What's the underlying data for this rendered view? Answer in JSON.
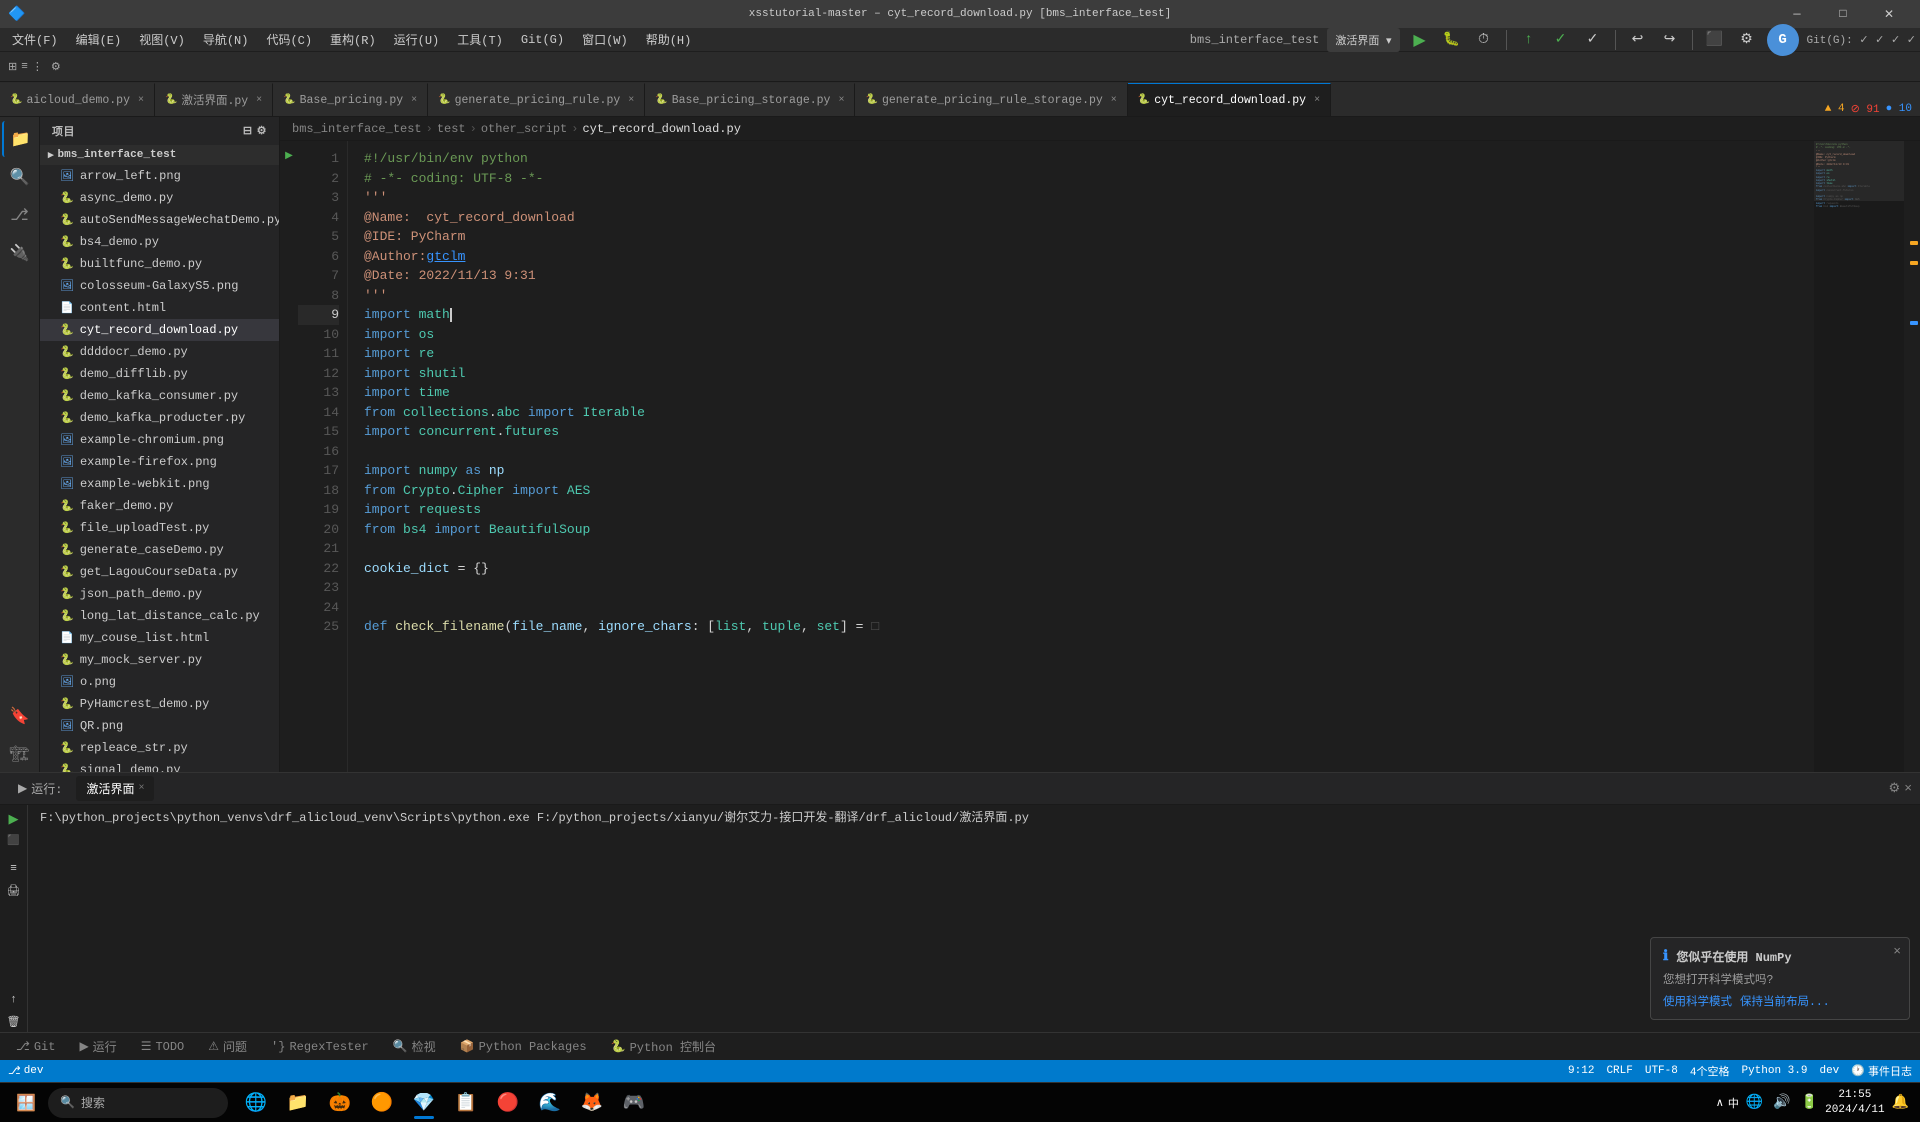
{
  "app": {
    "title": "xsstutorial-master – cyt_record_download.py [bms_interface_test]",
    "version": "PyCharm"
  },
  "titlebar": {
    "menu_items": [
      "文件(F)",
      "编辑(E)",
      "视图(V)",
      "导航(N)",
      "代码(C)",
      "重构(R)",
      "运行(U)",
      "工具(T)",
      "Git(G)",
      "窗口(W)",
      "帮助(H)"
    ],
    "project_name": "bms_interface_test",
    "minimize": "—",
    "maximize": "□",
    "close": "✕"
  },
  "breadcrumb": {
    "project": "bms_interface_test",
    "folder1": "test",
    "folder2": "other_script",
    "file": "cyt_record_download.py"
  },
  "tabs": [
    {
      "label": "aicloud_demo.py",
      "active": false,
      "icon": "🐍"
    },
    {
      "label": "激活界面.py",
      "active": false,
      "icon": "🐍"
    },
    {
      "label": "Base_pricing.py",
      "active": false,
      "icon": "🐍"
    },
    {
      "label": "generate_pricing_rule.py",
      "active": false,
      "icon": "🐍"
    },
    {
      "label": "Base_pricing_storage.py",
      "active": false,
      "icon": "🐍"
    },
    {
      "label": "generate_pricing_rule_storage.py",
      "active": false,
      "icon": "🐍"
    },
    {
      "label": "cyt_record_download.py",
      "active": true,
      "icon": "🐍"
    }
  ],
  "explorer": {
    "header": "项目",
    "sections": [
      {
        "name": "bms_interface_test",
        "files": [
          {
            "name": "arrow_left.png",
            "icon": "🖼",
            "type": "png"
          },
          {
            "name": "async_demo.py",
            "icon": "🐍",
            "type": "py"
          },
          {
            "name": "autoSendMessageWechatDemo.py",
            "icon": "🐍",
            "type": "py"
          },
          {
            "name": "bs4_demo.py",
            "icon": "🐍",
            "type": "py"
          },
          {
            "name": "builtfunc_demo.py",
            "icon": "🐍",
            "type": "py"
          },
          {
            "name": "colosseum-GalaxyS5.png",
            "icon": "🖼",
            "type": "png"
          },
          {
            "name": "content.html",
            "icon": "📄",
            "type": "html"
          },
          {
            "name": "cyt_record_download.py",
            "icon": "🐍",
            "type": "py",
            "active": true
          },
          {
            "name": "ddddocr_demo.py",
            "icon": "🐍",
            "type": "py"
          },
          {
            "name": "demo_difflib.py",
            "icon": "🐍",
            "type": "py"
          },
          {
            "name": "demo_kafka_consumer.py",
            "icon": "🐍",
            "type": "py"
          },
          {
            "name": "demo_kafka_producter.py",
            "icon": "🐍",
            "type": "py"
          },
          {
            "name": "example-chromium.png",
            "icon": "🖼",
            "type": "png"
          },
          {
            "name": "example-firefox.png",
            "icon": "🖼",
            "type": "png"
          },
          {
            "name": "example-webkit.png",
            "icon": "🖼",
            "type": "png"
          },
          {
            "name": "faker_demo.py",
            "icon": "🐍",
            "type": "py"
          },
          {
            "name": "file_uploadTest.py",
            "icon": "🐍",
            "type": "py"
          },
          {
            "name": "generate_caseDemo.py",
            "icon": "🐍",
            "type": "py"
          },
          {
            "name": "get_LagouCourseData.py",
            "icon": "🐍",
            "type": "py"
          },
          {
            "name": "json_path_demo.py",
            "icon": "🐍",
            "type": "py"
          },
          {
            "name": "long_lat_distance_calc.py",
            "icon": "🐍",
            "type": "py"
          },
          {
            "name": "my_couse_list.html",
            "icon": "📄",
            "type": "html"
          },
          {
            "name": "my_mock_server.py",
            "icon": "🐍",
            "type": "py"
          },
          {
            "name": "o.png",
            "icon": "🖼",
            "type": "png"
          },
          {
            "name": "PyHamcrest_demo.py",
            "icon": "🐍",
            "type": "py"
          },
          {
            "name": "QR.png",
            "icon": "🖼",
            "type": "png"
          },
          {
            "name": "repleace_str.py",
            "icon": "🐍",
            "type": "py"
          },
          {
            "name": "signal_demo.py",
            "icon": "🐍",
            "type": "py"
          }
        ]
      }
    ]
  },
  "code": {
    "filename": "cyt_record_download.py",
    "lines": [
      {
        "num": 1,
        "content": "#!/usr/bin/env python"
      },
      {
        "num": 2,
        "content": "# -*- coding: UTF-8 -*-"
      },
      {
        "num": 3,
        "content": "'''"
      },
      {
        "num": 4,
        "content": "@Name:  cyt_record_download"
      },
      {
        "num": 5,
        "content": "@IDE: PyCharm"
      },
      {
        "num": 6,
        "content": "@Author:gtclm"
      },
      {
        "num": 7,
        "content": "@Date: 2022/11/13 9:31"
      },
      {
        "num": 8,
        "content": "'''"
      },
      {
        "num": 9,
        "content": "import math"
      },
      {
        "num": 10,
        "content": "import os"
      },
      {
        "num": 11,
        "content": "import re"
      },
      {
        "num": 12,
        "content": "import shutil"
      },
      {
        "num": 13,
        "content": "import time"
      },
      {
        "num": 14,
        "content": "from collections.abc import Iterable"
      },
      {
        "num": 15,
        "content": "import concurrent.futures"
      },
      {
        "num": 16,
        "content": ""
      },
      {
        "num": 17,
        "content": "import numpy as np"
      },
      {
        "num": 18,
        "content": "from Crypto.Cipher import AES"
      },
      {
        "num": 19,
        "content": "import requests"
      },
      {
        "num": 20,
        "content": "from bs4 import BeautifulSoup"
      },
      {
        "num": 21,
        "content": ""
      },
      {
        "num": 22,
        "content": "cookie_dict = {}"
      },
      {
        "num": 23,
        "content": ""
      },
      {
        "num": 24,
        "content": ""
      },
      {
        "num": 25,
        "content": "def check_filename(file_name, ignore_chars: [list, tuple, set] = □"
      }
    ]
  },
  "run_panel": {
    "tabs": [
      "运行:",
      "激活界面"
    ],
    "active_tab": "激活界面",
    "output_path": "F:\\python_projects\\python_venvs\\drf_alicloud_venv\\Scripts\\python.exe F:/python_projects/xianyu/谢尔艾力-接口开发-翻译/drf_alicloud/激活界面.py"
  },
  "bottom_toolbar": {
    "items": [
      {
        "label": "Git",
        "icon": "⎇"
      },
      {
        "label": "运行",
        "icon": "▶"
      },
      {
        "label": "TODO",
        "icon": "☰"
      },
      {
        "label": "问题",
        "icon": "⚠"
      },
      {
        "label": "RegexTester",
        "icon": "'},"
      },
      {
        "label": "检视",
        "icon": "🔍"
      },
      {
        "label": "Python Packages",
        "icon": "📦"
      },
      {
        "label": "Python 控制台",
        "icon": "🐍"
      }
    ]
  },
  "status_bar": {
    "left": {
      "git_icon": "⎇",
      "branch": "dev"
    },
    "right": {
      "line_col": "9:12",
      "encoding": "CRLF",
      "charset": "UTF-8",
      "indent": "4个空格",
      "python_version": "Python 3.9",
      "env": "dev",
      "warnings": "▲ 4",
      "errors": "⊘ 91",
      "info": "10"
    }
  },
  "notification": {
    "title": "您似乎在使用 NumPy",
    "body": "您想打开科学模式吗?",
    "link1": "使用科学模式",
    "link2": "保持当前布局..."
  },
  "taskbar": {
    "search_placeholder": "搜索",
    "apps": [
      "🪟",
      "🌐",
      "📁",
      "💻",
      "🟠",
      "🌍",
      "📋",
      "🔴",
      "🌊",
      "🦊"
    ],
    "time": "21:55",
    "date": "2024/4/11",
    "language": "中"
  }
}
